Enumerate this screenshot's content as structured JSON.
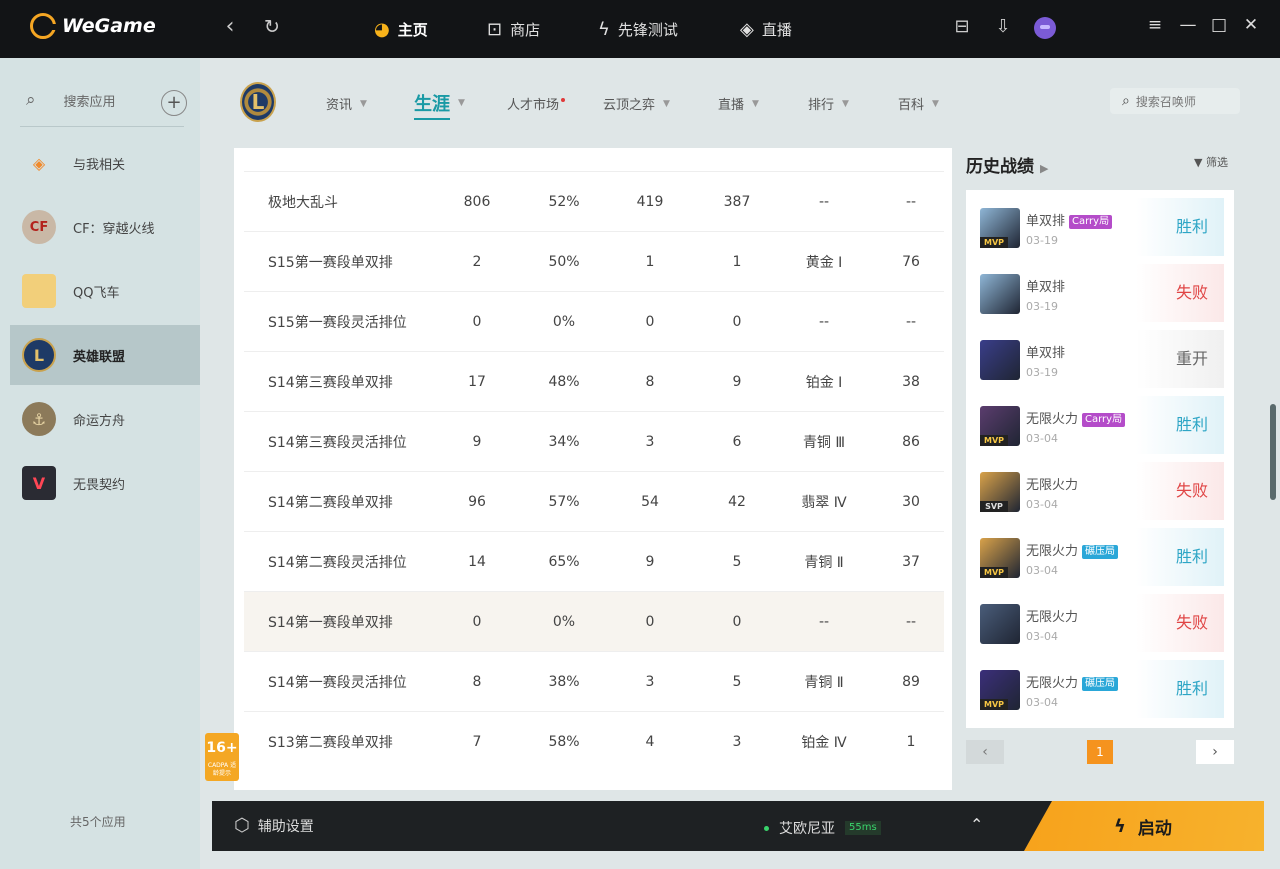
{
  "app": {
    "name": "WeGame"
  },
  "topnav": {
    "back_icon": "chevron-left-icon",
    "refresh_icon": "refresh-icon",
    "items": [
      {
        "label": "主页",
        "icon": "pacman-icon",
        "active": true
      },
      {
        "label": "商店",
        "icon": "shop-bag-icon",
        "active": false
      },
      {
        "label": "先锋测试",
        "icon": "lightning-icon",
        "active": false
      },
      {
        "label": "直播",
        "icon": "live-diamond-icon",
        "active": false
      }
    ]
  },
  "sidebar": {
    "search_label": "搜索应用",
    "items": [
      {
        "label": "与我相关",
        "icon": "related-icon",
        "active": false
      },
      {
        "label": "CF：穿越火线",
        "icon": "cf-icon",
        "active": false
      },
      {
        "label": "QQ飞车",
        "icon": "qq-speed-icon",
        "active": false
      },
      {
        "label": "英雄联盟",
        "icon": "lol-icon",
        "active": true
      },
      {
        "label": "命运方舟",
        "icon": "lost-ark-icon",
        "active": false
      },
      {
        "label": "无畏契约",
        "icon": "valorant-icon",
        "active": false
      }
    ],
    "count_label": "共5个应用"
  },
  "subnav": {
    "tabs": [
      {
        "label": "资讯",
        "active": false,
        "dot": false
      },
      {
        "label": "生涯",
        "active": true,
        "dot": false
      },
      {
        "label": "人才市场",
        "active": false,
        "dot": true
      },
      {
        "label": "云顶之弈",
        "active": false,
        "dot": false
      },
      {
        "label": "直播",
        "active": false,
        "dot": false
      },
      {
        "label": "排行",
        "active": false,
        "dot": false
      },
      {
        "label": "百科",
        "active": false,
        "dot": false
      }
    ],
    "search_placeholder": "搜索召唤师"
  },
  "stats": {
    "rows": [
      {
        "mode": "极地大乱斗",
        "games": "806",
        "winrate": "52%",
        "wins": "419",
        "losses": "387",
        "rank": "--",
        "points": "--",
        "highlight": false
      },
      {
        "mode": "S15第一赛段单双排",
        "games": "2",
        "winrate": "50%",
        "wins": "1",
        "losses": "1",
        "rank": "黄金 Ⅰ",
        "points": "76",
        "highlight": false
      },
      {
        "mode": "S15第一赛段灵活排位",
        "games": "0",
        "winrate": "0%",
        "wins": "0",
        "losses": "0",
        "rank": "--",
        "points": "--",
        "highlight": false
      },
      {
        "mode": "S14第三赛段单双排",
        "games": "17",
        "winrate": "48%",
        "wins": "8",
        "losses": "9",
        "rank": "铂金 Ⅰ",
        "points": "38",
        "highlight": false
      },
      {
        "mode": "S14第三赛段灵活排位",
        "games": "9",
        "winrate": "34%",
        "wins": "3",
        "losses": "6",
        "rank": "青铜 Ⅲ",
        "points": "86",
        "highlight": false
      },
      {
        "mode": "S14第二赛段单双排",
        "games": "96",
        "winrate": "57%",
        "wins": "54",
        "losses": "42",
        "rank": "翡翠 Ⅳ",
        "points": "30",
        "highlight": false
      },
      {
        "mode": "S14第二赛段灵活排位",
        "games": "14",
        "winrate": "65%",
        "wins": "9",
        "losses": "5",
        "rank": "青铜 Ⅱ",
        "points": "37",
        "highlight": false
      },
      {
        "mode": "S14第一赛段单双排",
        "games": "0",
        "winrate": "0%",
        "wins": "0",
        "losses": "0",
        "rank": "--",
        "points": "--",
        "highlight": true
      },
      {
        "mode": "S14第一赛段灵活排位",
        "games": "8",
        "winrate": "38%",
        "wins": "3",
        "losses": "5",
        "rank": "青铜 Ⅱ",
        "points": "89",
        "highlight": false
      },
      {
        "mode": "S13第二赛段单双排",
        "games": "7",
        "winrate": "58%",
        "wins": "4",
        "losses": "3",
        "rank": "铂金 Ⅳ",
        "points": "1",
        "highlight": false
      }
    ]
  },
  "age_badge": {
    "rating": "16+",
    "label": "CADPA",
    "note": "适龄提示"
  },
  "history": {
    "title": "历史战绩",
    "filter_label": "筛选",
    "matches": [
      {
        "mode": "单双排",
        "tag": "Carry局",
        "tag_color": "#b44cc9",
        "date": "03-19",
        "badge": "MVP",
        "result": "胜利",
        "result_type": "win",
        "champ_color": "#8fb6d6"
      },
      {
        "mode": "单双排",
        "tag": "",
        "tag_color": "",
        "date": "03-19",
        "badge": "",
        "result": "失败",
        "result_type": "lose",
        "champ_color": "#8fb6d6"
      },
      {
        "mode": "单双排",
        "tag": "",
        "tag_color": "",
        "date": "03-19",
        "badge": "",
        "result": "重开",
        "result_type": "remake",
        "champ_color": "#3a3e8a"
      },
      {
        "mode": "无限火力",
        "tag": "Carry局",
        "tag_color": "#b44cc9",
        "date": "03-04",
        "badge": "MVP",
        "result": "胜利",
        "result_type": "win",
        "champ_color": "#5b3d6e"
      },
      {
        "mode": "无限火力",
        "tag": "",
        "tag_color": "",
        "date": "03-04",
        "badge": "SVP",
        "result": "失败",
        "result_type": "lose",
        "champ_color": "#d9a24a"
      },
      {
        "mode": "无限火力",
        "tag": "碾压局",
        "tag_color": "#2aa7d8",
        "date": "03-04",
        "badge": "MVP",
        "result": "胜利",
        "result_type": "win",
        "champ_color": "#d9a24a"
      },
      {
        "mode": "无限火力",
        "tag": "",
        "tag_color": "",
        "date": "03-04",
        "badge": "",
        "result": "失败",
        "result_type": "lose",
        "champ_color": "#4a5d7a"
      },
      {
        "mode": "无限火力",
        "tag": "碾压局",
        "tag_color": "#2aa7d8",
        "date": "03-04",
        "badge": "MVP",
        "result": "胜利",
        "result_type": "win",
        "champ_color": "#3b2f7a"
      }
    ],
    "pager": {
      "prev": "‹",
      "current": "1",
      "next": "›"
    }
  },
  "bottombar": {
    "assist_label": "辅助设置",
    "server_name": "艾欧尼亚",
    "ping": "55ms",
    "launch_label": "启动"
  },
  "colors": {
    "accent": "#1a9aa5",
    "win": "#2da5c5",
    "lose": "#e04545",
    "launch": "#f7a21b"
  }
}
